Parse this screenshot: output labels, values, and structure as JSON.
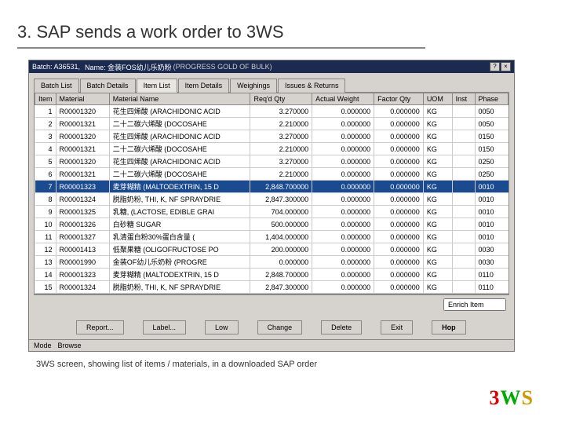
{
  "page": {
    "title": "3. SAP sends a work order to 3WS",
    "caption": "3WS screen, showing list of items / materials, in a downloaded SAP order"
  },
  "titlebar": {
    "batch_label": "Batch: A36531,",
    "name_label": "Name: 金装FOS幼儿乐奶粉",
    "extra": "(PROGRESS GOLD OF BULK)"
  },
  "tabs": {
    "items": [
      {
        "label": "Batch List"
      },
      {
        "label": "Batch Details"
      },
      {
        "label": "Item List"
      },
      {
        "label": "Item Details"
      },
      {
        "label": "Weighings"
      },
      {
        "label": "Issues & Returns"
      }
    ],
    "active_index": 2
  },
  "table": {
    "columns": [
      "Item",
      "Material",
      "Material Name",
      "Req'd Qty",
      "Actual Weight",
      "Factor Qty",
      "UOM",
      "Inst",
      "Phase"
    ],
    "rows": [
      {
        "idx": 1,
        "mat": "R00001320",
        "name": "花生四烯酸 (ARACHIDONIC ACID",
        "req": "3.270000",
        "act": "0.000000",
        "fac": "0.000000",
        "uom": "KG",
        "phase": "0050"
      },
      {
        "idx": 2,
        "mat": "R00001321",
        "name": "二十二碳六烯酸 (DOCOSAHE",
        "req": "2.210000",
        "act": "0.000000",
        "fac": "0.000000",
        "uom": "KG",
        "phase": "0050"
      },
      {
        "idx": 3,
        "mat": "R00001320",
        "name": "花生四烯酸 (ARACHIDONIC ACID",
        "req": "3.270000",
        "act": "0.000000",
        "fac": "0.000000",
        "uom": "KG",
        "phase": "0150"
      },
      {
        "idx": 4,
        "mat": "R00001321",
        "name": "二十二碳六烯酸 (DOCOSAHE",
        "req": "2.210000",
        "act": "0.000000",
        "fac": "0.000000",
        "uom": "KG",
        "phase": "0150"
      },
      {
        "idx": 5,
        "mat": "R00001320",
        "name": "花生四烯酸 (ARACHIDONIC ACID",
        "req": "3.270000",
        "act": "0.000000",
        "fac": "0.000000",
        "uom": "KG",
        "phase": "0250"
      },
      {
        "idx": 6,
        "mat": "R00001321",
        "name": "二十二碳六烯酸 (DOCOSAHE",
        "req": "2.210000",
        "act": "0.000000",
        "fac": "0.000000",
        "uom": "KG",
        "phase": "0250"
      },
      {
        "idx": 7,
        "mat": "R00001323",
        "name": "麦芽糊精 (MALTODEXTRIN, 15 D",
        "req": "2,848.700000",
        "act": "0.000000",
        "fac": "0.000000",
        "uom": "KG",
        "phase": "0010",
        "selected": true
      },
      {
        "idx": 8,
        "mat": "R00001324",
        "name": "脱脂奶粉, THI, K, NF SPRAYDRIE",
        "req": "2,847.300000",
        "act": "0.000000",
        "fac": "0.000000",
        "uom": "KG",
        "phase": "0010"
      },
      {
        "idx": 9,
        "mat": "R00001325",
        "name": "乳糖, (LACTOSE, EDIBLE GRAI",
        "req": "704.000000",
        "act": "0.000000",
        "fac": "0.000000",
        "uom": "KG",
        "phase": "0010"
      },
      {
        "idx": 10,
        "mat": "R00001326",
        "name": "白砂糖 SUGAR",
        "req": "500.000000",
        "act": "0.000000",
        "fac": "0.000000",
        "uom": "KG",
        "phase": "0010"
      },
      {
        "idx": 11,
        "mat": "R00001327",
        "name": "乳清蛋白粉30%蛋白含量 (",
        "req": "1,404.000000",
        "act": "0.000000",
        "fac": "0.000000",
        "uom": "KG",
        "phase": "0010"
      },
      {
        "idx": 12,
        "mat": "R00001413",
        "name": "低聚果糖 (OLIGOFRUCTOSE PO",
        "req": "200.000000",
        "act": "0.000000",
        "fac": "0.000000",
        "uom": "KG",
        "phase": "0030"
      },
      {
        "idx": 13,
        "mat": "R00001990",
        "name": "金装OF幼儿乐奶粉 (PROGRE",
        "req": "0.000000",
        "act": "0.000000",
        "fac": "0.000000",
        "uom": "KG",
        "phase": "0030"
      },
      {
        "idx": 14,
        "mat": "R00001323",
        "name": "麦芽糊精 (MALTODEXTRIN, 15 D",
        "req": "2,848.700000",
        "act": "0.000000",
        "fac": "0.000000",
        "uom": "KG",
        "phase": "0110"
      },
      {
        "idx": 15,
        "mat": "R00001324",
        "name": "脱脂奶粉, THI, K, NF SPRAYDRIE",
        "req": "2,847.300000",
        "act": "0.000000",
        "fac": "0.000000",
        "uom": "KG",
        "phase": "0110"
      }
    ]
  },
  "enrich": {
    "label": "Enrich Item"
  },
  "buttons": {
    "report": "Report...",
    "label": "Label...",
    "low": "Low",
    "change": "Change",
    "delete": "Delete",
    "exit": "Exit",
    "hop": "Hop"
  },
  "statusbar": {
    "mode_label": "Mode",
    "mode_value": "Browse"
  },
  "logo": {
    "c3": "3",
    "cW": "W",
    "cS": "S"
  }
}
